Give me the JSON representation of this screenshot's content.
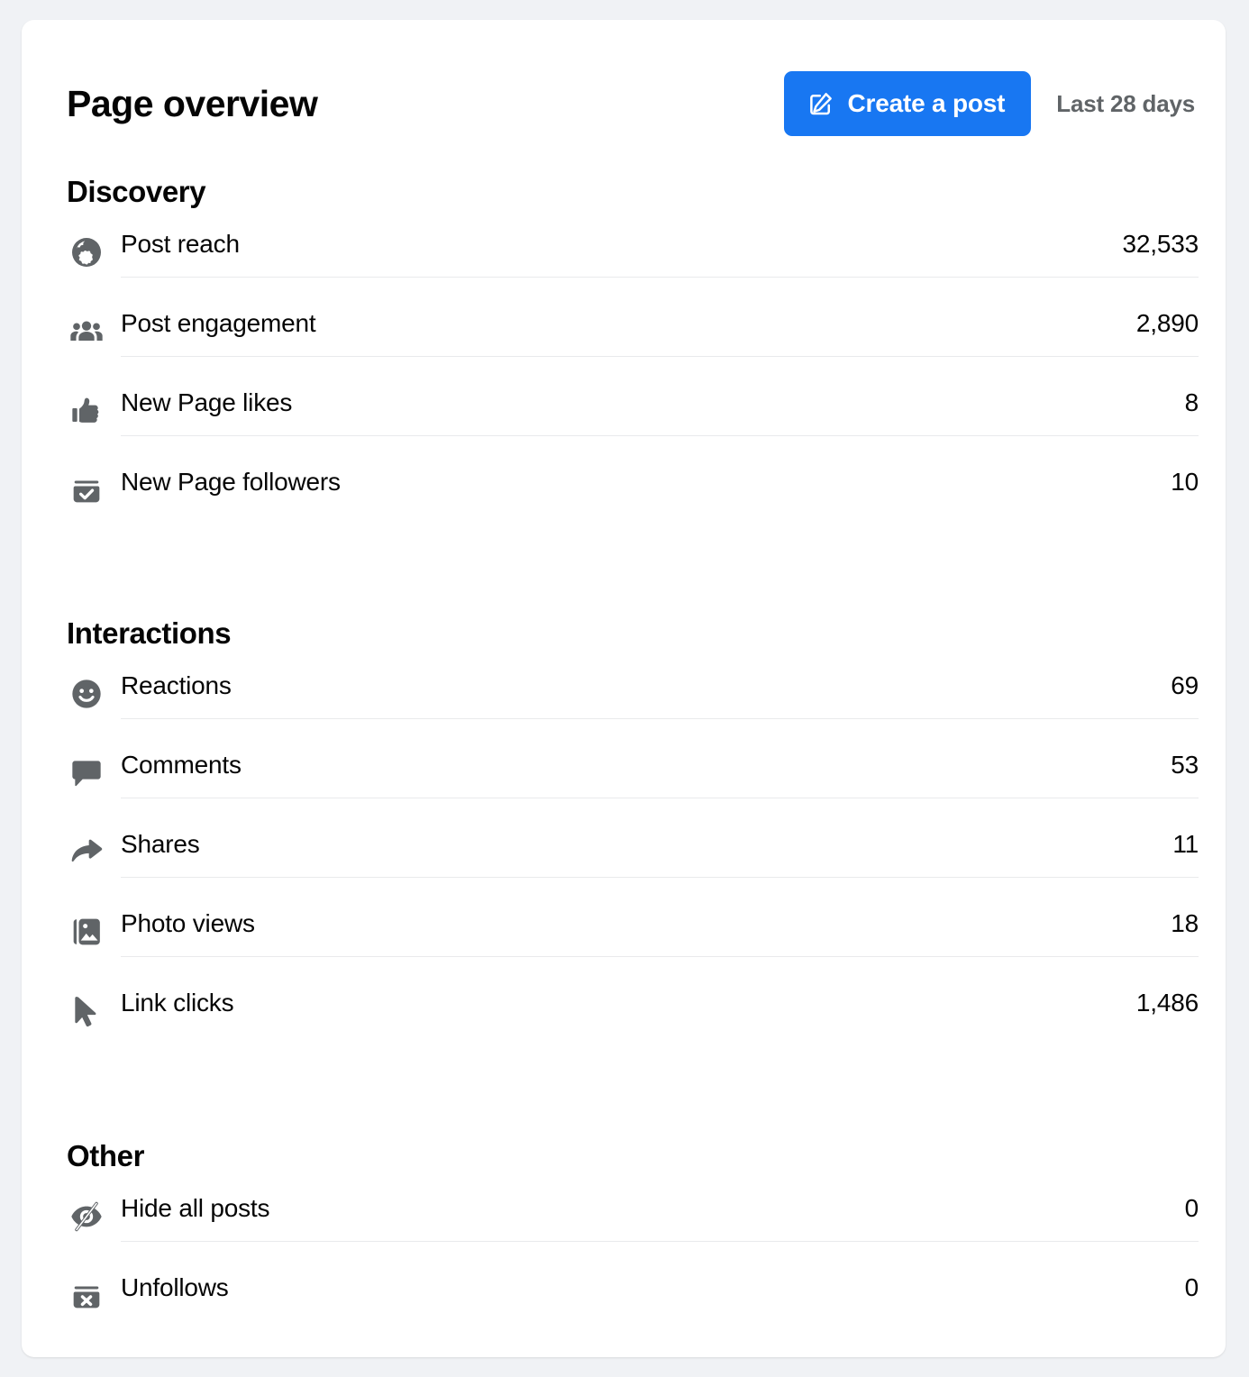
{
  "header": {
    "title": "Page overview",
    "create_post_label": "Create a post",
    "create_post_icon": "compose-icon",
    "date_range": "Last 28 days",
    "accent_color": "#1877f2",
    "date_range_color": "#606467"
  },
  "sections": [
    {
      "title": "Discovery",
      "rows": [
        {
          "icon": "globe-icon",
          "label": "Post reach",
          "value": "32,533"
        },
        {
          "icon": "people-icon",
          "label": "Post engagement",
          "value": "2,890"
        },
        {
          "icon": "thumbsup-icon",
          "label": "New Page likes",
          "value": "8"
        },
        {
          "icon": "follow-icon",
          "label": "New Page followers",
          "value": "10"
        }
      ]
    },
    {
      "title": "Interactions",
      "rows": [
        {
          "icon": "smiley-icon",
          "label": "Reactions",
          "value": "69"
        },
        {
          "icon": "comment-icon",
          "label": "Comments",
          "value": "53"
        },
        {
          "icon": "share-icon",
          "label": "Shares",
          "value": "11"
        },
        {
          "icon": "photo-icon",
          "label": "Photo views",
          "value": "18"
        },
        {
          "icon": "cursor-icon",
          "label": "Link clicks",
          "value": "1,486"
        }
      ]
    },
    {
      "title": "Other",
      "rows": [
        {
          "icon": "eye-slash-icon",
          "label": "Hide all posts",
          "value": "0"
        },
        {
          "icon": "unfollow-icon",
          "label": "Unfollows",
          "value": "0"
        }
      ]
    }
  ]
}
